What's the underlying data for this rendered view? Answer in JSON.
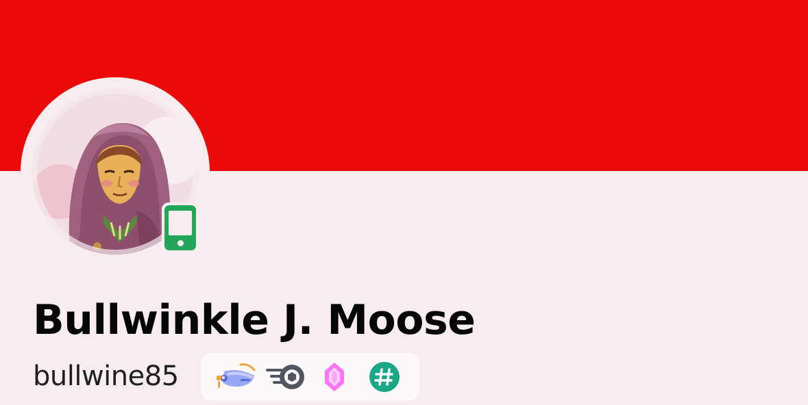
{
  "profile": {
    "display_name": "Bullwinkle J. Moose",
    "username": "bullwine85",
    "banner_color": "#ec0909",
    "status": "mobile-online",
    "status_color": "#23a55a",
    "avatar_description": "hooded-character-avatar"
  },
  "badges": [
    {
      "icon": "quest-badge-icon"
    },
    {
      "icon": "nitro-badge-icon"
    },
    {
      "icon": "server-boost-gem-icon"
    },
    {
      "icon": "hashtag-badge-icon"
    }
  ]
}
